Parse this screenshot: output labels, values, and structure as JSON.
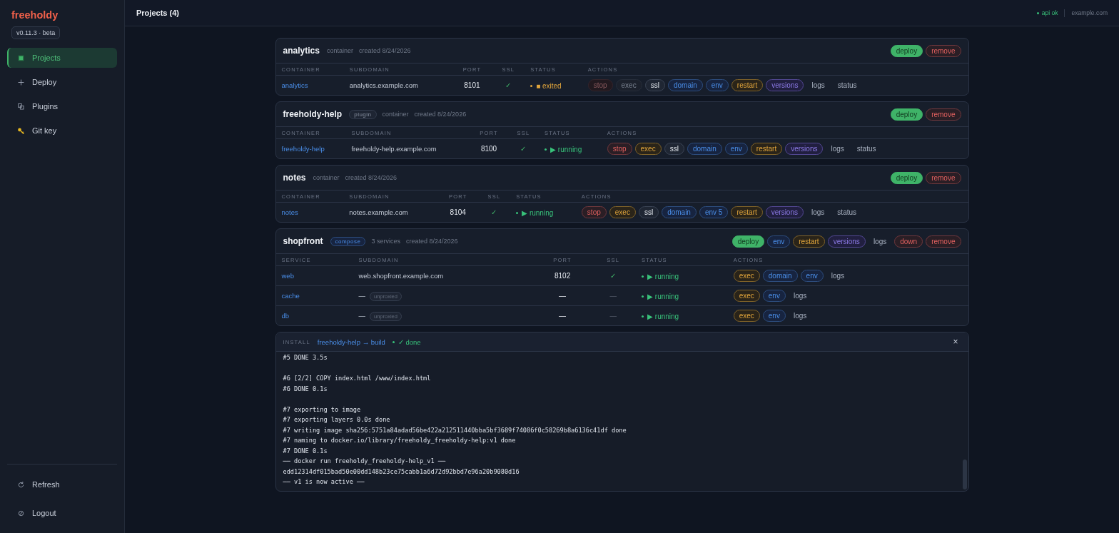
{
  "sidebar": {
    "brand": "freeholdy",
    "version": "v0.11.3 · beta",
    "nav": [
      {
        "label": "Projects",
        "kind": "projects",
        "selected": true
      },
      {
        "label": "Deploy",
        "kind": "deploy",
        "selected": false
      },
      {
        "label": "Plugins",
        "kind": "plugins",
        "selected": false
      },
      {
        "label": "Git key",
        "kind": "key",
        "selected": false
      }
    ],
    "footer": [
      {
        "label": "Refresh",
        "kind": "refresh"
      },
      {
        "label": "Logout",
        "kind": "logout"
      }
    ]
  },
  "topbar": {
    "title": "Projects (4)",
    "api_status": "api ok",
    "domain": "example.com"
  },
  "projects": [
    {
      "name": "analytics",
      "type": "container",
      "created": "created 8/24/2026",
      "header_actions": [
        {
          "label": "deploy",
          "kind": "primary"
        },
        {
          "label": "remove",
          "kind": "danger"
        }
      ],
      "columns": [
        "CONTAINER",
        "SUBDOMAIN",
        "PORT",
        "SSL",
        "STATUS",
        "ACTIONS"
      ],
      "rows": [
        {
          "name": "analytics",
          "subdomain": "analytics.example.com",
          "port": "8101",
          "ssl": "✓",
          "status": {
            "kind": "exited",
            "text": "■ exited"
          },
          "actions": [
            {
              "label": "stop",
              "kind": "danger",
              "disabled": true
            },
            {
              "label": "exec",
              "kind": "neutral",
              "disabled": true
            },
            {
              "label": "ssl",
              "kind": "neutral",
              "disabled": false
            },
            {
              "label": "domain",
              "kind": "info",
              "disabled": false
            },
            {
              "label": "env",
              "kind": "info",
              "disabled": false
            },
            {
              "label": "restart",
              "kind": "warn",
              "disabled": false
            },
            {
              "label": "versions",
              "kind": "accent",
              "disabled": false
            },
            {
              "label": "logs",
              "kind": "link",
              "disabled": false
            },
            {
              "label": "status",
              "kind": "link",
              "disabled": false
            }
          ]
        }
      ]
    },
    {
      "name": "freeholdy-help",
      "badge": {
        "text": "plugin",
        "kind": "plain"
      },
      "type": "container",
      "created": "created 8/24/2026",
      "header_actions": [
        {
          "label": "deploy",
          "kind": "primary"
        },
        {
          "label": "remove",
          "kind": "danger"
        }
      ],
      "columns": [
        "CONTAINER",
        "SUBDOMAIN",
        "PORT",
        "SSL",
        "STATUS",
        "ACTIONS"
      ],
      "rows": [
        {
          "name": "freeholdy-help",
          "subdomain": "freeholdy-help.example.com",
          "port": "8100",
          "ssl": "✓",
          "status": {
            "kind": "running",
            "text": "▶ running"
          },
          "actions": [
            {
              "label": "stop",
              "kind": "danger",
              "disabled": false
            },
            {
              "label": "exec",
              "kind": "warn",
              "disabled": false
            },
            {
              "label": "ssl",
              "kind": "neutral",
              "disabled": false
            },
            {
              "label": "domain",
              "kind": "info",
              "disabled": false
            },
            {
              "label": "env",
              "kind": "info",
              "disabled": false
            },
            {
              "label": "restart",
              "kind": "warn",
              "disabled": false
            },
            {
              "label": "versions",
              "kind": "accent",
              "disabled": false
            },
            {
              "label": "logs",
              "kind": "link",
              "disabled": false
            },
            {
              "label": "status",
              "kind": "link",
              "disabled": false
            }
          ]
        }
      ]
    },
    {
      "name": "notes",
      "type": "container",
      "created": "created 8/24/2026",
      "header_actions": [
        {
          "label": "deploy",
          "kind": "primary"
        },
        {
          "label": "remove",
          "kind": "danger"
        }
      ],
      "columns": [
        "CONTAINER",
        "SUBDOMAIN",
        "PORT",
        "SSL",
        "STATUS",
        "ACTIONS"
      ],
      "rows": [
        {
          "name": "notes",
          "subdomain": "notes.example.com",
          "port": "8104",
          "ssl": "✓",
          "status": {
            "kind": "running",
            "text": "▶ running"
          },
          "actions": [
            {
              "label": "stop",
              "kind": "danger",
              "disabled": false
            },
            {
              "label": "exec",
              "kind": "warn",
              "disabled": false
            },
            {
              "label": "ssl",
              "kind": "neutral",
              "disabled": false
            },
            {
              "label": "domain",
              "kind": "info",
              "disabled": false
            },
            {
              "label": "env 5",
              "kind": "info",
              "disabled": false
            },
            {
              "label": "restart",
              "kind": "warn",
              "disabled": false
            },
            {
              "label": "versions",
              "kind": "accent",
              "disabled": false
            },
            {
              "label": "logs",
              "kind": "link",
              "disabled": false
            },
            {
              "label": "status",
              "kind": "link",
              "disabled": false
            }
          ]
        }
      ]
    },
    {
      "name": "shopfront",
      "badge": {
        "text": "compose",
        "kind": "info"
      },
      "type": "3 services",
      "created": "created 8/24/2026",
      "header_actions": [
        {
          "label": "deploy",
          "kind": "primary"
        },
        {
          "label": "env",
          "kind": "info"
        },
        {
          "label": "restart",
          "kind": "warn"
        },
        {
          "label": "versions",
          "kind": "accent"
        },
        {
          "label": "logs",
          "kind": "link"
        },
        {
          "label": "down",
          "kind": "danger"
        },
        {
          "label": "remove",
          "kind": "danger"
        }
      ],
      "columns": [
        "SERVICE",
        "SUBDOMAIN",
        "PORT",
        "SSL",
        "STATUS",
        "ACTIONS"
      ],
      "rows": [
        {
          "name": "web",
          "subdomain": "web.shopfront.example.com",
          "port": "8102",
          "ssl": "✓",
          "status": {
            "kind": "running",
            "text": "▶ running"
          },
          "actions": [
            {
              "label": "exec",
              "kind": "warn",
              "disabled": false
            },
            {
              "label": "domain",
              "kind": "info",
              "disabled": false
            },
            {
              "label": "env",
              "kind": "info",
              "disabled": false
            },
            {
              "label": "logs",
              "kind": "link",
              "disabled": false
            }
          ]
        },
        {
          "name": "cache",
          "subdomain": "—",
          "unproxied": "unproxied",
          "port": "—",
          "ssl": "—",
          "status": {
            "kind": "running",
            "text": "▶ running"
          },
          "actions": [
            {
              "label": "exec",
              "kind": "warn",
              "disabled": false
            },
            {
              "label": "env",
              "kind": "info",
              "disabled": false
            },
            {
              "label": "logs",
              "kind": "link",
              "disabled": false
            }
          ]
        },
        {
          "name": "db",
          "subdomain": "—",
          "unproxied": "unproxied",
          "port": "—",
          "ssl": "—",
          "status": {
            "kind": "running",
            "text": "▶ running"
          },
          "actions": [
            {
              "label": "exec",
              "kind": "warn",
              "disabled": false
            },
            {
              "label": "env",
              "kind": "info",
              "disabled": false
            },
            {
              "label": "logs",
              "kind": "link",
              "disabled": false
            }
          ]
        }
      ]
    }
  ],
  "install": {
    "label": "INSTALL",
    "target": "freeholdy-help → build",
    "status": {
      "kind": "done",
      "text": "✓ done"
    },
    "close": "×",
    "log_blocks": [
      [
        "#5 DONE 3.5s"
      ],
      [
        "#6 [2/2] COPY index.html /www/index.html",
        "#6 DONE 0.1s"
      ],
      [
        "#7 exporting to image",
        "#7 exporting layers 0.0s done",
        "#7 writing image sha256:5751a84adad56be422a212511440bba5bf3689f74086f0c58269b8a6136c41df done",
        "#7 naming to docker.io/library/freeholdy_freeholdy-help:v1 done",
        "#7 DONE 0.1s",
        "── docker run freeholdy_freeholdy-help_v1 ──",
        "edd12314df015bad50e00dd148b23ce75cabb1a6d72d92bbd7e96a20b9080d16",
        "── v1 is now active ──"
      ]
    ]
  }
}
